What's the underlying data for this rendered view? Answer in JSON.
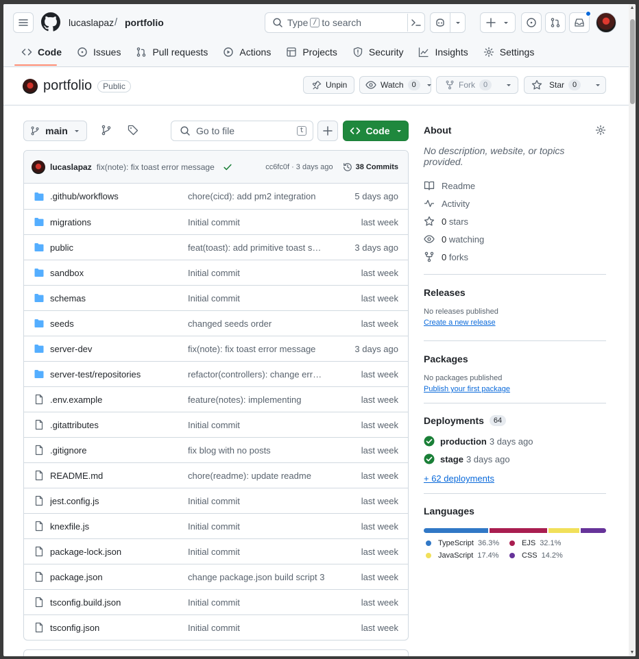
{
  "header": {
    "owner": "lucaslapaz",
    "separator": "/",
    "repo": "portfolio",
    "search_prefix": "Type",
    "search_key": "/",
    "search_suffix": "to search",
    "tabs": [
      {
        "label": "Code",
        "icon": "code-icon"
      },
      {
        "label": "Issues",
        "icon": "issue-icon"
      },
      {
        "label": "Pull requests",
        "icon": "pull-request-icon"
      },
      {
        "label": "Actions",
        "icon": "play-icon"
      },
      {
        "label": "Projects",
        "icon": "table-icon"
      },
      {
        "label": "Security",
        "icon": "shield-icon"
      },
      {
        "label": "Insights",
        "icon": "graph-icon"
      },
      {
        "label": "Settings",
        "icon": "gear-icon"
      }
    ]
  },
  "repo": {
    "name": "portfolio",
    "visibility": "Public",
    "unpin_label": "Unpin",
    "watch_label": "Watch",
    "watch_count": "0",
    "fork_label": "Fork",
    "fork_count": "0",
    "star_label": "Star",
    "star_count": "0"
  },
  "toolbar": {
    "branch": "main",
    "goto_placeholder": "Go to file",
    "goto_key": "t",
    "code_label": "Code"
  },
  "commit": {
    "author": "lucaslapaz",
    "message": "fix(note): fix toast error message",
    "hash_time": "cc6fc0f · 3 days ago",
    "commits_label": "38 Commits"
  },
  "files": [
    {
      "type": "dir",
      "name": ".github/workflows",
      "message": "chore(cicd): add pm2 integration",
      "time": "5 days ago"
    },
    {
      "type": "dir",
      "name": "migrations",
      "message": "Initial commit",
      "time": "last week"
    },
    {
      "type": "dir",
      "name": "public",
      "message": "feat(toast): add primitive toast sys…",
      "time": "3 days ago"
    },
    {
      "type": "dir",
      "name": "sandbox",
      "message": "Initial commit",
      "time": "last week"
    },
    {
      "type": "dir",
      "name": "schemas",
      "message": "Initial commit",
      "time": "last week"
    },
    {
      "type": "dir",
      "name": "seeds",
      "message": "changed seeds order",
      "time": "last week"
    },
    {
      "type": "dir",
      "name": "server-dev",
      "message": "fix(note): fix toast error message",
      "time": "3 days ago"
    },
    {
      "type": "dir",
      "name": "server-test/repositories",
      "message": "refactor(controllers): change error…",
      "time": "last week"
    },
    {
      "type": "file",
      "name": ".env.example",
      "message": "feature(notes): implementing",
      "time": "last week"
    },
    {
      "type": "file",
      "name": ".gitattributes",
      "message": "Initial commit",
      "time": "last week"
    },
    {
      "type": "file",
      "name": ".gitignore",
      "message": "fix blog with no posts",
      "time": "last week"
    },
    {
      "type": "file",
      "name": "README.md",
      "message": "chore(readme): update readme",
      "time": "last week"
    },
    {
      "type": "file",
      "name": "jest.config.js",
      "message": "Initial commit",
      "time": "last week"
    },
    {
      "type": "file",
      "name": "knexfile.js",
      "message": "Initial commit",
      "time": "last week"
    },
    {
      "type": "file",
      "name": "package-lock.json",
      "message": "Initial commit",
      "time": "last week"
    },
    {
      "type": "file",
      "name": "package.json",
      "message": "change package.json build script 3",
      "time": "last week"
    },
    {
      "type": "file",
      "name": "tsconfig.build.json",
      "message": "Initial commit",
      "time": "last week"
    },
    {
      "type": "file",
      "name": "tsconfig.json",
      "message": "Initial commit",
      "time": "last week"
    }
  ],
  "about": {
    "title": "About",
    "description": "No description, website, or topics provided.",
    "readme": "Readme",
    "activity": "Activity",
    "stars_count": "0",
    "stars_label": "stars",
    "watching_count": "0",
    "watching_label": "watching",
    "forks_count": "0",
    "forks_label": "forks"
  },
  "releases": {
    "title": "Releases",
    "empty": "No releases published",
    "link": "Create a new release"
  },
  "packages": {
    "title": "Packages",
    "empty": "No packages published",
    "link": "Publish your first package"
  },
  "deployments": {
    "title": "Deployments",
    "count": "64",
    "items": [
      {
        "env": "production",
        "time": "3 days ago"
      },
      {
        "env": "stage",
        "time": "3 days ago"
      }
    ],
    "more": "+ 62 deployments"
  },
  "languages": {
    "title": "Languages",
    "items": [
      {
        "name": "TypeScript",
        "percent": "36.3%",
        "value": 36.3,
        "color": "#3178c6"
      },
      {
        "name": "EJS",
        "percent": "32.1%",
        "value": 32.1,
        "color": "#a91e50"
      },
      {
        "name": "JavaScript",
        "percent": "17.4%",
        "value": 17.4,
        "color": "#f1e05a"
      },
      {
        "name": "CSS",
        "percent": "14.2%",
        "value": 14.2,
        "color": "#663399"
      }
    ]
  },
  "colors": {
    "accent_green": "#1f883d",
    "link_blue": "#0969da",
    "folder_blue": "#54aeff",
    "tab_underline": "#fd8c73"
  }
}
